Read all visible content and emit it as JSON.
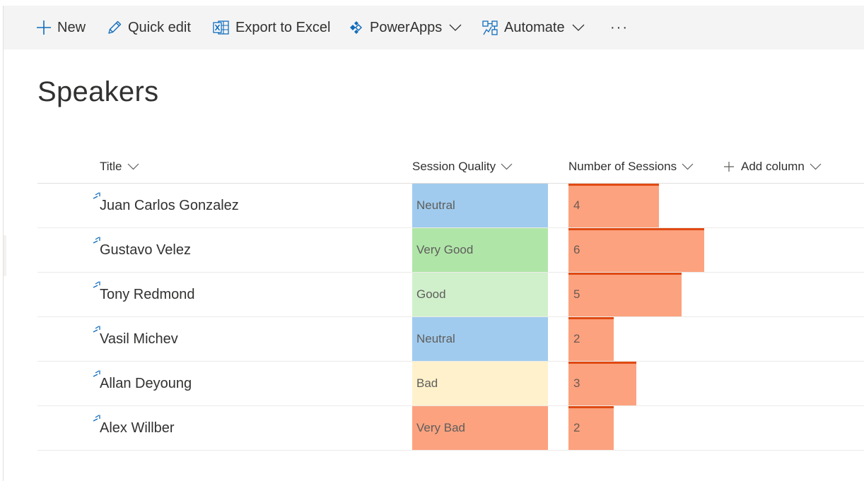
{
  "commandbar": {
    "new_label": "New",
    "quick_edit_label": "Quick edit",
    "export_label": "Export to Excel",
    "powerapps_label": "PowerApps",
    "automate_label": "Automate",
    "more_label": "···"
  },
  "page": {
    "title": "Speakers"
  },
  "columns": {
    "title": "Title",
    "session_quality": "Session Quality",
    "number_of_sessions": "Number of Sessions",
    "add_column": "Add column"
  },
  "quality_colors": {
    "Neutral": "#a0cbee",
    "Very Good": "#b0e5a8",
    "Good": "#d0f0cb",
    "Bad": "#fff1cc",
    "Very Bad": "#fca27f"
  },
  "rows": [
    {
      "title": "Juan Carlos Gonzalez",
      "quality": "Neutral",
      "sessions": "4",
      "sessions_value": 4
    },
    {
      "title": "Gustavo Velez",
      "quality": "Very Good",
      "sessions": "6",
      "sessions_value": 6
    },
    {
      "title": "Tony Redmond",
      "quality": "Good",
      "sessions": "5",
      "sessions_value": 5
    },
    {
      "title": "Vasil Michev",
      "quality": "Neutral",
      "sessions": "2",
      "sessions_value": 2
    },
    {
      "title": "Allan Deyoung",
      "quality": "Bad",
      "sessions": "3",
      "sessions_value": 3
    },
    {
      "title": "Alex Willber",
      "quality": "Very Bad",
      "sessions": "2",
      "sessions_value": 2
    }
  ],
  "sessions_max": 6
}
